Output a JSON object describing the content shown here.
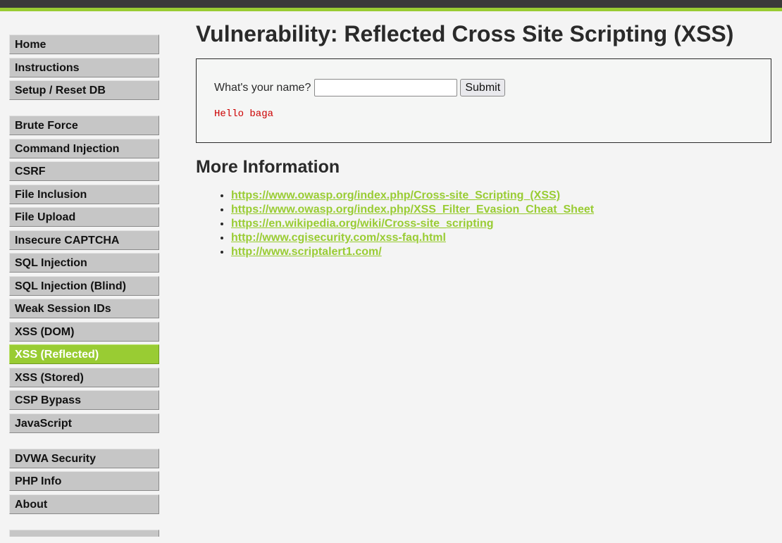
{
  "colors": {
    "accent": "#99cc33",
    "topbar": "#3a3a3a",
    "menu_bg": "#c6c6c6",
    "output_text": "#cc0000"
  },
  "sidebar": {
    "groups": [
      [
        "Home",
        "Instructions",
        "Setup / Reset DB"
      ],
      [
        "Brute Force",
        "Command Injection",
        "CSRF",
        "File Inclusion",
        "File Upload",
        "Insecure CAPTCHA",
        "SQL Injection",
        "SQL Injection (Blind)",
        "Weak Session IDs",
        "XSS (DOM)",
        "XSS (Reflected)",
        "XSS (Stored)",
        "CSP Bypass",
        "JavaScript"
      ],
      [
        "DVWA Security",
        "PHP Info",
        "About"
      ]
    ],
    "selected": "XSS (Reflected)"
  },
  "main": {
    "title": "Vulnerability: Reflected Cross Site Scripting (XSS)",
    "form": {
      "label": "What's your name?",
      "input_value": "",
      "submit_label": "Submit"
    },
    "output": "Hello baga",
    "more_info_title": "More Information",
    "links": [
      "https://www.owasp.org/index.php/Cross-site_Scripting_(XSS)",
      "https://www.owasp.org/index.php/XSS_Filter_Evasion_Cheat_Sheet",
      "https://en.wikipedia.org/wiki/Cross-site_scripting",
      "http://www.cgisecurity.com/xss-faq.html",
      "http://www.scriptalert1.com/"
    ]
  }
}
